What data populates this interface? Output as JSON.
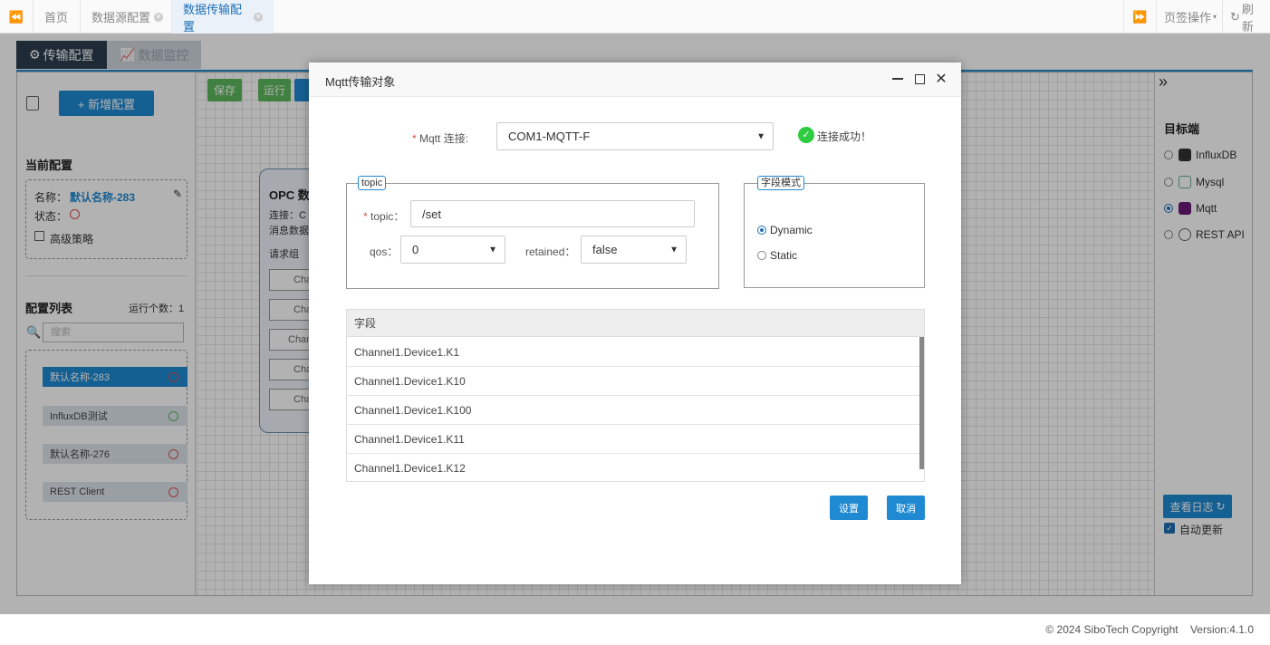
{
  "topbar": {
    "tabs": [
      {
        "label": "首页"
      },
      {
        "label": "数据源配置"
      },
      {
        "label": "数据传输配置"
      }
    ],
    "page_ops": "页签操作",
    "refresh": "刷新"
  },
  "app": {
    "subtabs": {
      "transfer": "传输配置",
      "monitor": "数据监控"
    },
    "toolbar": {
      "add_config": "+ 新增配置",
      "save": "保存",
      "run": "运行"
    },
    "current_config": {
      "title": "当前配置",
      "name_label": "名称：",
      "name_value": "默认名称-283",
      "status_label": "状态：",
      "advanced_label": "高级策略"
    },
    "config_list": {
      "title": "配置列表",
      "running_count": "运行个数：1",
      "search_placeholder": "搜索",
      "items": [
        {
          "label": "默认名称-283",
          "status": "stopped"
        },
        {
          "label": "InfluxDB测试",
          "status": "running"
        },
        {
          "label": "默认名称-276",
          "status": "stopped"
        },
        {
          "label": "REST Client",
          "status": "stopped"
        }
      ]
    },
    "opc_node": {
      "title": "OPC 数",
      "conn_label": "连接：",
      "conn_value": "C",
      "msg_label": "消息数据",
      "req_label": "请求组",
      "channels": [
        "Cha",
        "Cha",
        "Chan",
        "Cha",
        "Cha"
      ]
    },
    "target": {
      "title": "目标端",
      "options": [
        {
          "label": "InfluxDB",
          "selected": false
        },
        {
          "label": "Mysql",
          "selected": false
        },
        {
          "label": "Mqtt",
          "selected": true
        },
        {
          "label": "REST API",
          "selected": false
        }
      ],
      "view_log": "查看日志",
      "auto_update": "自动更新"
    }
  },
  "modal": {
    "title": "Mqtt传输对象",
    "mqtt_conn_label": "Mqtt 连接:",
    "mqtt_conn_value": "COM1-MQTT-F",
    "conn_status": "连接成功！",
    "topic_legend": "topic",
    "topic_label": "topic：",
    "topic_value": "/set",
    "qos_label": "qos：",
    "qos_value": "0",
    "retained_label": "retained：",
    "retained_value": "false",
    "field_mode_legend": "字段模式",
    "mode_options": [
      {
        "label": "Dynamic",
        "selected": true
      },
      {
        "label": "Static",
        "selected": false
      }
    ],
    "table_header": "字段",
    "fields": [
      "Channel1.Device1.K1",
      "Channel1.Device1.K10",
      "Channel1.Device1.K100",
      "Channel1.Device1.K11",
      "Channel1.Device1.K12"
    ],
    "set_button": "设置",
    "cancel_button": "取消"
  },
  "footer": {
    "text": "© 2024 SiboTech Copyright    Version:4.1.0"
  },
  "colors": {
    "accent": "#1f8ad2",
    "success": "#5cb85c",
    "danger": "#d9534f",
    "dark": "#2c3e50"
  }
}
